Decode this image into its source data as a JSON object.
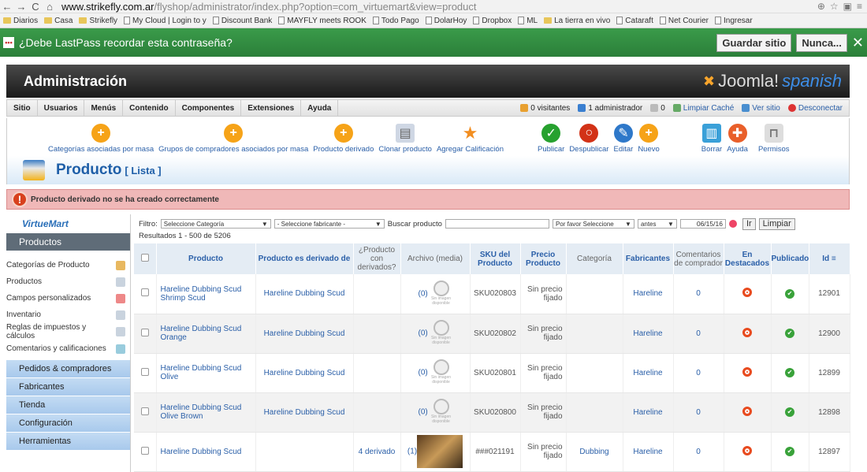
{
  "browser": {
    "url_host": "www.strikefly.com.ar",
    "url_path": "/flyshop/administrator/index.php?option=com_virtuemart&view=product",
    "bookmarks": [
      "Diarios",
      "Casa",
      "Strikefly",
      "My Cloud | Login to y",
      "Discount Bank",
      "MAYFLY meets ROOK",
      "Todo Pago",
      "DolarHoy",
      "Dropbox",
      "ML",
      "La tierra en vivo",
      "Cataraft",
      "Net Courier",
      "Ingresar"
    ]
  },
  "lastpass": {
    "message": "¿Debe LastPass recordar esta contraseña?",
    "save_label": "Guardar sitio",
    "never_label": "Nunca..."
  },
  "header": {
    "title": "Administración",
    "brand": "Joomla!",
    "brand_lang": "spanish"
  },
  "menu": {
    "items": [
      "Sitio",
      "Usuarios",
      "Menús",
      "Contenido",
      "Componentes",
      "Extensiones",
      "Ayuda"
    ],
    "visitors": "0 visitantes",
    "admins": "1 administrador",
    "messages": "0",
    "clear_cache": "Limpiar Caché",
    "view_site": "Ver sitio",
    "logout": "Desconectar"
  },
  "toolbar": {
    "cat_assign": "Categorías asociadas por masa",
    "group_assign": "Grupos de compradores asociados por masa",
    "derived": "Producto derivado",
    "clone": "Clonar producto",
    "rate": "Agregar Calificación",
    "publish": "Publicar",
    "unpublish": "Despublicar",
    "edit": "Editar",
    "new": "Nuevo",
    "delete": "Borrar",
    "help": "Ayuda",
    "perms": "Permisos"
  },
  "page": {
    "title": "Producto",
    "subtitle": "[ Lista ]",
    "error": "Producto derivado no se ha creado correctamente"
  },
  "sidebar": {
    "logo": "VirtueMart",
    "section_products": "Productos",
    "items": [
      "Categorías de Producto",
      "Productos",
      "Campos personalizados",
      "Inventario",
      "Reglas de impuestos y cálculos",
      "Comentarios y calificaciones"
    ],
    "sections": [
      "Pedidos & compradores",
      "Fabricantes",
      "Tienda",
      "Configuración",
      "Herramientas"
    ]
  },
  "filter": {
    "label": "Filtro:",
    "category": "Seleccione Categoría",
    "manufacturer": "- Seleccione fabricante -",
    "search_label": "Buscar producto",
    "search_value": "",
    "pick": "Por favor Seleccione",
    "before": "antes",
    "date": "06/15/16",
    "go": "Ir",
    "reset": "Limpiar",
    "results": "Resultados 1 - 500 de 5206"
  },
  "table": {
    "headers": [
      "Producto",
      "Producto es derivado de",
      "¿Producto con derivados?",
      "Archivo (media)",
      "SKU del Producto",
      "Precio Producto",
      "Categoría",
      "Fabricantes",
      "Comentarios de comprador",
      "En Destacados",
      "Publicado",
      "Id"
    ],
    "no_image": "Sin imagen disponible",
    "rows": [
      {
        "name": "Hareline Dubbing Scud Shrimp Scud",
        "parent": "Hareline Dubbing Scud",
        "derived": "",
        "media": "(0)",
        "sku": "SKU020803",
        "price": "Sin precio fijado",
        "category": "",
        "maker": "Hareline",
        "reviews": "0",
        "id": "12901"
      },
      {
        "name": "Hareline Dubbing Scud Orange",
        "parent": "Hareline Dubbing Scud",
        "derived": "",
        "media": "(0)",
        "sku": "SKU020802",
        "price": "Sin precio fijado",
        "category": "",
        "maker": "Hareline",
        "reviews": "0",
        "id": "12900"
      },
      {
        "name": "Hareline Dubbing Scud Olive",
        "parent": "Hareline Dubbing Scud",
        "derived": "",
        "media": "(0)",
        "sku": "SKU020801",
        "price": "Sin precio fijado",
        "category": "",
        "maker": "Hareline",
        "reviews": "0",
        "id": "12899"
      },
      {
        "name": "Hareline Dubbing Scud Olive Brown",
        "parent": "Hareline Dubbing Scud",
        "derived": "",
        "media": "(0)",
        "sku": "SKU020800",
        "price": "Sin precio fijado",
        "category": "",
        "maker": "Hareline",
        "reviews": "0",
        "id": "12898"
      },
      {
        "name": "Hareline Dubbing Scud",
        "parent": "",
        "derived": "4 derivado",
        "media": "(1)",
        "sku": "###021191",
        "price": "Sin precio fijado",
        "category": "Dubbing",
        "maker": "Hareline",
        "reviews": "0",
        "id": "12897"
      }
    ]
  }
}
